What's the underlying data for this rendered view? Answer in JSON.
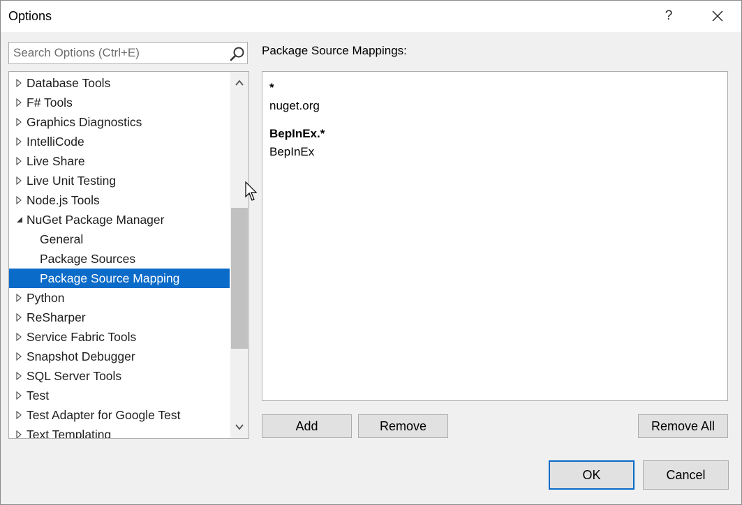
{
  "window": {
    "title": "Options",
    "help_label": "?"
  },
  "search": {
    "placeholder": "Search Options (Ctrl+E)"
  },
  "tree": {
    "items": [
      {
        "label": "Database Tools",
        "expanded": false
      },
      {
        "label": "F# Tools",
        "expanded": false
      },
      {
        "label": "Graphics Diagnostics",
        "expanded": false
      },
      {
        "label": "IntelliCode",
        "expanded": false
      },
      {
        "label": "Live Share",
        "expanded": false
      },
      {
        "label": "Live Unit Testing",
        "expanded": false
      },
      {
        "label": "Node.js Tools",
        "expanded": false
      },
      {
        "label": "NuGet Package Manager",
        "expanded": true
      },
      {
        "label": "General",
        "child": true
      },
      {
        "label": "Package Sources",
        "child": true
      },
      {
        "label": "Package Source Mapping",
        "child": true,
        "selected": true
      },
      {
        "label": "Python",
        "expanded": false
      },
      {
        "label": "ReSharper",
        "expanded": false
      },
      {
        "label": "Service Fabric Tools",
        "expanded": false
      },
      {
        "label": "Snapshot Debugger",
        "expanded": false
      },
      {
        "label": "SQL Server Tools",
        "expanded": false
      },
      {
        "label": "Test",
        "expanded": false
      },
      {
        "label": "Test Adapter for Google Test",
        "expanded": false
      },
      {
        "label": "Text Templating",
        "expanded": false
      }
    ]
  },
  "mappings": {
    "label": "Package Source Mappings:",
    "groups": [
      {
        "pattern": "*",
        "source": "nuget.org"
      },
      {
        "pattern": "BepInEx.*",
        "source": "BepInEx"
      }
    ]
  },
  "buttons": {
    "add": "Add",
    "remove": "Remove",
    "remove_all": "Remove All",
    "ok": "OK",
    "cancel": "Cancel"
  },
  "colors": {
    "selection": "#0a6bc9",
    "default_button_border": "#0a6bc9",
    "button_face": "#e1e1e1"
  }
}
